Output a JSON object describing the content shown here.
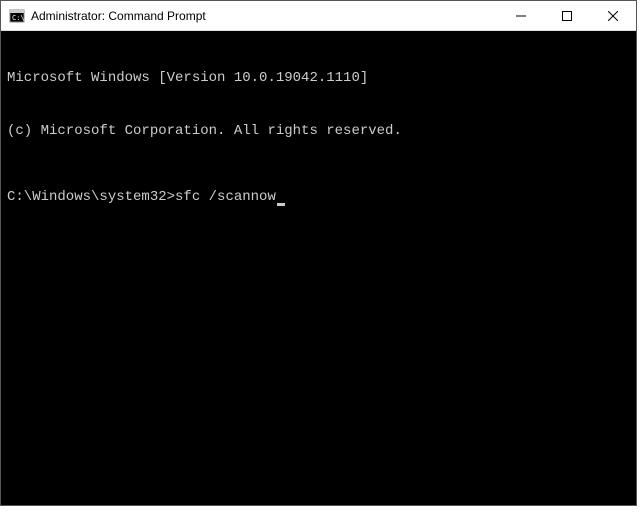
{
  "window": {
    "title": "Administrator: Command Prompt"
  },
  "terminal": {
    "line1": "Microsoft Windows [Version 10.0.19042.1110]",
    "line2": "(c) Microsoft Corporation. All rights reserved.",
    "prompt": "C:\\Windows\\system32>",
    "command": "sfc /scannow"
  }
}
